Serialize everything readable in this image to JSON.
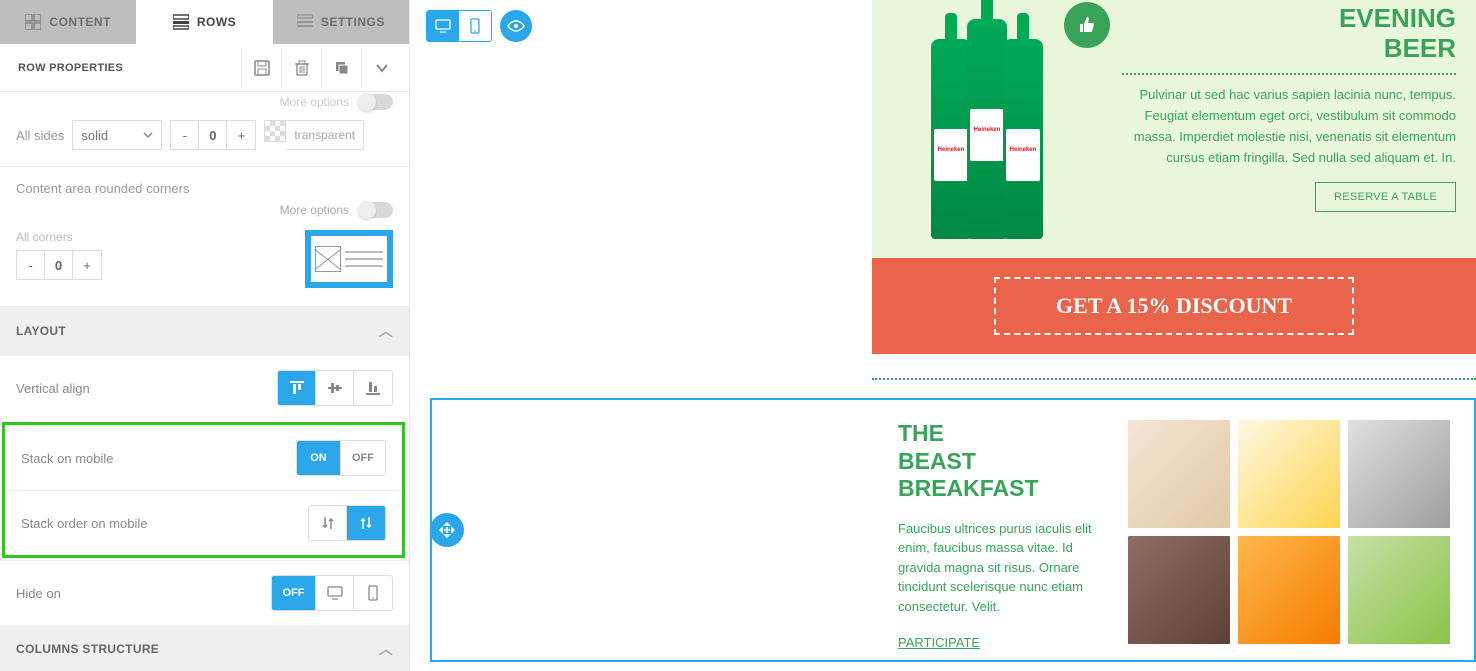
{
  "tabs": {
    "content": "CONTENT",
    "rows": "ROWS",
    "settings": "SETTINGS"
  },
  "panel": {
    "title": "ROW PROPERTIES"
  },
  "more_options": "More options",
  "border": {
    "all_sides": "All sides",
    "style": "solid",
    "value": "0",
    "transparent": "transparent"
  },
  "corners": {
    "label": "Content area rounded corners",
    "all": "All corners",
    "value": "0"
  },
  "sections": {
    "layout": "LAYOUT",
    "columns": "COLUMNS STRUCTURE"
  },
  "layout": {
    "valign": "Vertical align",
    "stack": "Stack on mobile",
    "on": "ON",
    "off": "OFF",
    "order": "Stack order on mobile",
    "hide": "Hide on"
  },
  "email": {
    "beer_title_1": "EVENING",
    "beer_title_2": "BEER",
    "beer_text": "Pulvinar ut sed hac varius sapien lacinia nunc, tempus. Feugiat elementum eget orci, vestibulum sit commodo massa. Imperdiet molestie nisi, venenatis sit elementum cursus etiam fringilla. Sed nulla sed aliquam et. In.",
    "reserve": "RESERVE A TABLE",
    "bottle_label": "Heineken",
    "discount": "GET A 15% DISCOUNT",
    "bf_title_1": "THE",
    "bf_title_2": "BEAST",
    "bf_title_3": "BREAKFAST",
    "bf_text": "Faucibus ultrices purus iaculis elit enim, faucibus massa vitae. Id gravida magna sit risus. Ornare tincidunt scelerisque nunc etiam consectetur. Velit.",
    "participate": "PARTICIPATE"
  }
}
